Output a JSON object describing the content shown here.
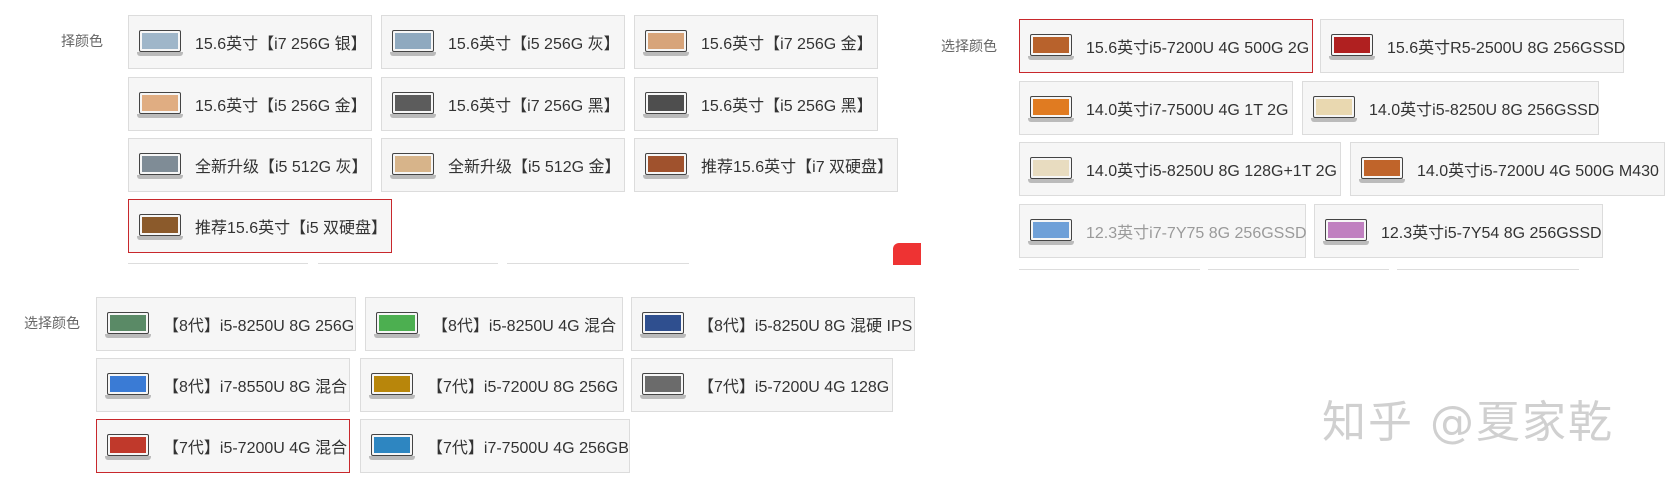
{
  "panel1": {
    "label": "择颜色",
    "options": [
      {
        "label": "15.6英寸【i7 256G 银】",
        "selected": false,
        "screen": "#9fb6c9"
      },
      {
        "label": "15.6英寸【i5 256G 灰】",
        "selected": false,
        "screen": "#8fa9bf"
      },
      {
        "label": "15.6英寸【i7 256G 金】",
        "selected": false,
        "screen": "#d7a47a"
      },
      {
        "label": "15.6英寸【i5 256G 金】",
        "selected": false,
        "screen": "#e0ad82"
      },
      {
        "label": "15.6英寸【i7 256G 黑】",
        "selected": false,
        "screen": "#5c5c5c"
      },
      {
        "label": "15.6英寸【i5 256G 黑】",
        "selected": false,
        "screen": "#4e4e4e"
      },
      {
        "label": "全新升级【i5 512G 灰】",
        "selected": false,
        "screen": "#7f8c96"
      },
      {
        "label": "全新升级【i5 512G 金】",
        "selected": false,
        "screen": "#d7b48a"
      },
      {
        "label": "推荐15.6英寸【i7 双硬盘】",
        "selected": false,
        "screen": "#a0522d"
      },
      {
        "label": "推荐15.6英寸【i5 双硬盘】",
        "selected": true,
        "screen": "#8b5a2b"
      }
    ]
  },
  "panel2": {
    "label": "选择颜色",
    "options": [
      {
        "label": "15.6英寸i5-7200U 4G 500G 2G",
        "selected": true,
        "dim": false,
        "screen": "#b8622c"
      },
      {
        "label": "15.6英寸R5-2500U 8G 256GSSD",
        "selected": false,
        "dim": false,
        "screen": "#b02020"
      },
      {
        "label": "14.0英寸i7-7500U 4G 1T 2G",
        "selected": false,
        "dim": false,
        "screen": "#e07b21"
      },
      {
        "label": "14.0英寸i5-8250U 8G 256GSSD",
        "selected": false,
        "dim": false,
        "screen": "#e9d8b0"
      },
      {
        "label": "14.0英寸i5-8250U 8G 128G+1T 2G",
        "selected": false,
        "dim": false,
        "screen": "#e8dcc0"
      },
      {
        "label": "14.0英寸i5-7200U 4G 500G M430",
        "selected": false,
        "dim": false,
        "screen": "#c0642a"
      },
      {
        "label": "12.3英寸i7-7Y75 8G 256GSSD",
        "selected": false,
        "dim": true,
        "screen": "#6fa0d8"
      },
      {
        "label": "12.3英寸i5-7Y54 8G 256GSSD",
        "selected": false,
        "dim": false,
        "screen": "#c080c0"
      }
    ]
  },
  "panel3": {
    "label": "选择颜色",
    "options": [
      {
        "label": "【8代】i5-8250U 8G 256G",
        "selected": false,
        "screen": "#5a8a66"
      },
      {
        "label": "【8代】i5-8250U 4G 混合",
        "selected": false,
        "screen": "#4caf50"
      },
      {
        "label": "【8代】i5-8250U 8G 混硬 IPS",
        "selected": false,
        "screen": "#2f4f8f"
      },
      {
        "label": "【8代】i7-8550U 8G 混合",
        "selected": false,
        "screen": "#3a7bd5"
      },
      {
        "label": "【7代】i5-7200U 8G 256G",
        "selected": false,
        "screen": "#b8860b"
      },
      {
        "label": "【7代】i5-7200U 4G 128G",
        "selected": false,
        "screen": "#6b6b6b"
      },
      {
        "label": "【7代】i5-7200U 4G 混合",
        "selected": true,
        "screen": "#c0392b"
      },
      {
        "label": "【7代】i7-7500U 4G 256GB",
        "selected": false,
        "screen": "#2e86c1"
      }
    ]
  },
  "watermark": "知乎 @夏家乾",
  "colors": {
    "selected_border": "#c8282c",
    "option_bg": "#f6f6f6",
    "option_border": "#dcdcdc"
  }
}
